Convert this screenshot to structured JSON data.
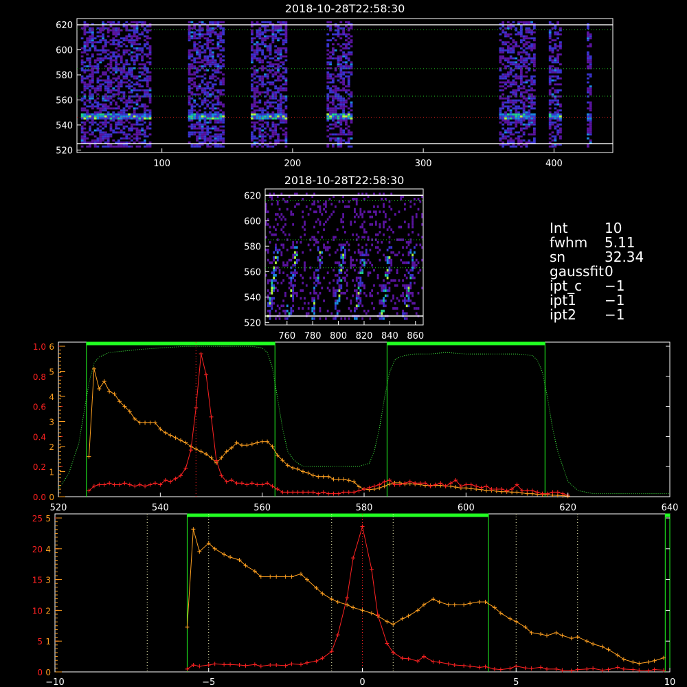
{
  "chart_data": [
    {
      "type": "heatmap",
      "title": "2018-10-28T22:58:30",
      "xlim": [
        35,
        445
      ],
      "ylim": [
        518,
        625
      ],
      "xticks": [
        100,
        200,
        300,
        400
      ],
      "yticks": [
        520,
        540,
        560,
        580,
        600,
        620
      ],
      "hlines_dotted": [
        546,
        563,
        585,
        616
      ],
      "hlines_white": [
        525,
        620
      ],
      "bright_row": 546,
      "segments": [
        [
          38,
          92
        ],
        [
          120,
          148
        ],
        [
          168,
          196
        ],
        [
          226,
          246
        ],
        [
          358,
          386
        ],
        [
          396,
          405
        ],
        [
          425,
          428
        ]
      ]
    },
    {
      "type": "heatmap",
      "title": "2018-10-28T22:58:30",
      "xlim": [
        743,
        866
      ],
      "ylim": [
        518,
        625
      ],
      "xticks": [
        760,
        780,
        800,
        820,
        840,
        860
      ],
      "yticks": [
        520,
        540,
        560,
        580,
        600,
        620
      ],
      "hlines_dotted": [
        563,
        585,
        616
      ],
      "hlines_white": [
        525,
        620
      ],
      "streaks": [
        745,
        760,
        779,
        797,
        813,
        833,
        851
      ]
    },
    {
      "type": "line",
      "xlim": [
        520,
        640
      ],
      "xticks": [
        520,
        540,
        560,
        580,
        600,
        620,
        640
      ],
      "left_ticks_red": [
        "0.0",
        "0.2",
        "0.4",
        "0.6",
        "0.8",
        "1.0"
      ],
      "left_ticks_orange": [
        "0",
        "1",
        "2",
        "3",
        "4",
        "5",
        "6"
      ],
      "red_ylim": [
        0,
        1.0
      ],
      "orange_ylim": [
        0,
        6.0
      ],
      "green_bars": [
        [
          525.5,
          562.5
        ],
        [
          584.5,
          615.5
        ]
      ],
      "vline_dotted": 547,
      "red_series": {
        "x": [
          526,
          527,
          528,
          529,
          530,
          531,
          532,
          533,
          534,
          535,
          536,
          537,
          538,
          539,
          540,
          541,
          542,
          543,
          544,
          545,
          546,
          547,
          548,
          549,
          550,
          551,
          552,
          553,
          554,
          555,
          556,
          557,
          558,
          559,
          560,
          561,
          562,
          563,
          564,
          565,
          566,
          567,
          568,
          569,
          570,
          571,
          572,
          573,
          574,
          575,
          576,
          577,
          578,
          579,
          580,
          581,
          582,
          583,
          584,
          585,
          586,
          587,
          588,
          589,
          590,
          591,
          592,
          593,
          594,
          595,
          596,
          597,
          598,
          599,
          600,
          601,
          602,
          603,
          604,
          605,
          606,
          607,
          608,
          609,
          610,
          611,
          612,
          613,
          614,
          615,
          616,
          617,
          618,
          619,
          620
        ],
        "y": [
          0.04,
          0.07,
          0.08,
          0.08,
          0.09,
          0.08,
          0.08,
          0.09,
          0.08,
          0.07,
          0.08,
          0.07,
          0.08,
          0.09,
          0.08,
          0.11,
          0.1,
          0.12,
          0.14,
          0.19,
          0.31,
          0.59,
          0.95,
          0.81,
          0.53,
          0.24,
          0.14,
          0.1,
          0.11,
          0.09,
          0.09,
          0.08,
          0.09,
          0.08,
          0.08,
          0.09,
          0.07,
          0.05,
          0.03,
          0.03,
          0.03,
          0.03,
          0.03,
          0.03,
          0.03,
          0.02,
          0.03,
          0.02,
          0.02,
          0.02,
          0.03,
          0.03,
          0.03,
          0.04,
          0.05,
          0.06,
          0.07,
          0.08,
          0.1,
          0.11,
          0.08,
          0.08,
          0.09,
          0.1,
          0.09,
          0.09,
          0.09,
          0.07,
          0.08,
          0.09,
          0.07,
          0.09,
          0.11,
          0.07,
          0.08,
          0.08,
          0.07,
          0.06,
          0.07,
          0.05,
          0.05,
          0.05,
          0.04,
          0.05,
          0.08,
          0.04,
          0.04,
          0.04,
          0.03,
          0.02,
          0.02,
          0.03,
          0.03,
          0.02,
          0.01
        ]
      },
      "orange_series": {
        "x": [
          526,
          527,
          528,
          529,
          530,
          531,
          532,
          533,
          534,
          535,
          536,
          537,
          538,
          539,
          540,
          541,
          542,
          543,
          544,
          545,
          546,
          547,
          548,
          549,
          550,
          551,
          552,
          553,
          554,
          555,
          556,
          557,
          558,
          559,
          560,
          561,
          562,
          563,
          564,
          565,
          566,
          567,
          568,
          569,
          570,
          571,
          572,
          573,
          574,
          575,
          576,
          577,
          578,
          579,
          580,
          581,
          582,
          583,
          584,
          585,
          586,
          587,
          588,
          589,
          590,
          591,
          592,
          593,
          594,
          595,
          596,
          597,
          598,
          599,
          600,
          601,
          602,
          603,
          604,
          605,
          606,
          607,
          608,
          609,
          610,
          611,
          612,
          613,
          614,
          615,
          616,
          617,
          618,
          619,
          620
        ],
        "y": [
          1.6,
          5.1,
          4.3,
          4.6,
          4.2,
          4.1,
          3.8,
          3.6,
          3.4,
          3.1,
          2.95,
          2.95,
          2.95,
          2.95,
          2.7,
          2.55,
          2.45,
          2.35,
          2.25,
          2.15,
          2.0,
          1.9,
          1.8,
          1.7,
          1.55,
          1.35,
          1.55,
          1.8,
          1.95,
          2.15,
          2.05,
          2.05,
          2.1,
          2.15,
          2.2,
          2.2,
          2.0,
          1.65,
          1.45,
          1.25,
          1.15,
          1.1,
          1.0,
          0.95,
          0.85,
          0.8,
          0.8,
          0.8,
          0.7,
          0.7,
          0.7,
          0.65,
          0.6,
          0.4,
          0.3,
          0.28,
          0.3,
          0.35,
          0.42,
          0.5,
          0.55,
          0.55,
          0.5,
          0.52,
          0.5,
          0.48,
          0.45,
          0.45,
          0.45,
          0.45,
          0.42,
          0.42,
          0.38,
          0.35,
          0.35,
          0.32,
          0.3,
          0.28,
          0.25,
          0.25,
          0.22,
          0.2,
          0.2,
          0.18,
          0.18,
          0.15,
          0.12,
          0.12,
          0.1,
          0.08,
          0.08,
          0.06,
          0.05,
          0.04,
          0.02
        ]
      },
      "transmission": {
        "x": [
          520,
          522,
          524,
          525,
          526,
          527,
          528,
          530,
          533,
          536,
          540,
          545,
          550,
          555,
          558,
          560,
          561,
          562,
          563,
          564,
          565,
          566,
          567,
          568,
          570,
          573,
          576,
          579,
          581,
          582,
          583,
          584,
          585,
          586,
          587,
          588,
          590,
          593,
          596,
          600,
          605,
          610,
          613,
          614,
          615,
          616,
          617,
          618,
          619,
          620,
          622,
          625,
          630,
          635,
          640
        ],
        "y": [
          0.05,
          0.15,
          0.35,
          0.55,
          0.75,
          0.88,
          0.92,
          0.95,
          0.96,
          0.97,
          0.98,
          0.99,
          0.99,
          0.99,
          0.99,
          0.98,
          0.95,
          0.85,
          0.65,
          0.45,
          0.3,
          0.25,
          0.22,
          0.2,
          0.2,
          0.2,
          0.2,
          0.2,
          0.22,
          0.3,
          0.45,
          0.65,
          0.82,
          0.9,
          0.92,
          0.93,
          0.94,
          0.94,
          0.95,
          0.94,
          0.94,
          0.94,
          0.93,
          0.9,
          0.82,
          0.65,
          0.45,
          0.3,
          0.2,
          0.1,
          0.04,
          0.02,
          0.02,
          0.02,
          0.02
        ]
      }
    },
    {
      "type": "line",
      "xlim": [
        -10,
        10
      ],
      "xticks": [
        "−10",
        "−5",
        "0",
        "5",
        "10"
      ],
      "xtick_values": [
        -10,
        -5,
        0,
        5,
        10
      ],
      "left_ticks_red": [
        "0",
        "5",
        "10",
        "15",
        "20",
        "25"
      ],
      "left_ticks_orange": [
        "0",
        "1",
        "2",
        "3",
        "4",
        "5"
      ],
      "red_ylim": [
        0,
        27
      ],
      "orange_ylim": [
        0,
        5.5
      ],
      "green_bars": [
        [
          -5.7,
          4.1
        ],
        [
          9.85,
          10
        ]
      ],
      "dotted_vlines": [
        -7,
        -5,
        -1,
        0,
        1,
        5,
        7
      ],
      "red_series": {
        "x": [
          -5.7,
          -5.5,
          -5.3,
          -5,
          -4.8,
          -4.5,
          -4.3,
          -4,
          -3.8,
          -3.5,
          -3.3,
          -3,
          -2.8,
          -2.5,
          -2.3,
          -2,
          -1.8,
          -1.5,
          -1.3,
          -1,
          -0.8,
          -0.5,
          -0.3,
          0,
          0.3,
          0.5,
          0.8,
          1,
          1.3,
          1.5,
          1.8,
          2,
          2.3,
          2.5,
          2.8,
          3,
          3.3,
          3.5,
          3.8,
          4,
          4.3,
          4.5,
          4.8,
          5,
          5.3,
          5.5,
          5.8,
          6,
          6.3,
          6.5,
          6.8,
          7,
          7.3,
          7.5,
          7.8,
          8,
          8.3,
          8.5,
          8.8,
          9,
          9.3,
          9.5,
          9.8
        ],
        "y": [
          0.5,
          1.2,
          1.0,
          1.2,
          1.4,
          1.3,
          1.3,
          1.2,
          1.1,
          1.3,
          1.0,
          1.2,
          1.2,
          1.1,
          1.4,
          1.3,
          1.6,
          1.9,
          2.4,
          3.6,
          6.5,
          13,
          20,
          25.5,
          18,
          10,
          5,
          3.4,
          2.4,
          2.3,
          1.9,
          2.7,
          1.8,
          1.7,
          1.4,
          1.2,
          1.1,
          1.0,
          0.8,
          0.9,
          0.5,
          0.4,
          0.6,
          1.0,
          0.7,
          0.6,
          0.8,
          0.5,
          0.5,
          0.3,
          0.2,
          0.4,
          0.5,
          0.6,
          0.3,
          0.4,
          0.8,
          0.5,
          0.4,
          0.3,
          0.2,
          0.4,
          0.3
        ]
      },
      "orange_series": {
        "x": [
          -5.7,
          -5.5,
          -5.3,
          -5,
          -4.8,
          -4.5,
          -4.3,
          -4,
          -3.8,
          -3.5,
          -3.3,
          -3,
          -2.8,
          -2.5,
          -2.3,
          -2,
          -1.8,
          -1.5,
          -1.3,
          -1,
          -0.8,
          -0.5,
          -0.3,
          0,
          0.3,
          0.5,
          0.8,
          1,
          1.3,
          1.5,
          1.8,
          2,
          2.3,
          2.5,
          2.8,
          3,
          3.3,
          3.5,
          3.8,
          4,
          4.3,
          4.5,
          4.8,
          5,
          5.3,
          5.5,
          5.8,
          6,
          6.3,
          6.5,
          6.8,
          7,
          7.3,
          7.5,
          7.8,
          8,
          8.3,
          8.5,
          8.8,
          9,
          9.3,
          9.5,
          9.8
        ],
        "y": [
          1.6,
          5.1,
          4.3,
          4.6,
          4.4,
          4.2,
          4.1,
          4.0,
          3.8,
          3.6,
          3.4,
          3.4,
          3.4,
          3.4,
          3.4,
          3.5,
          3.3,
          3.0,
          2.8,
          2.6,
          2.5,
          2.4,
          2.3,
          2.2,
          2.1,
          2.0,
          1.8,
          1.7,
          1.9,
          2.0,
          2.2,
          2.4,
          2.6,
          2.5,
          2.4,
          2.4,
          2.4,
          2.45,
          2.5,
          2.5,
          2.3,
          2.1,
          1.9,
          1.8,
          1.6,
          1.4,
          1.35,
          1.3,
          1.4,
          1.3,
          1.2,
          1.25,
          1.1,
          1.0,
          0.9,
          0.8,
          0.6,
          0.45,
          0.35,
          0.3,
          0.35,
          0.4,
          0.5
        ]
      }
    }
  ],
  "info": [
    {
      "label": "Int",
      "value": "10"
    },
    {
      "label": "fwhm",
      "value": "5.11"
    },
    {
      "label": "sn",
      "value": "32.34"
    },
    {
      "label": "gaussfit",
      "value": "0"
    },
    {
      "label": "ipt_c",
      "value": "−1"
    },
    {
      "label": "ipt1",
      "value": "−1"
    },
    {
      "label": "ipt2",
      "value": "−1"
    }
  ],
  "colors": {
    "axis": "#ffffff",
    "red": "#ff2222",
    "orange": "#ffa020",
    "green": "#22ff22",
    "green_dotted": "#22cc22",
    "cyan_dotted": "#22aacc",
    "dotted_white": "#ffffc0"
  }
}
